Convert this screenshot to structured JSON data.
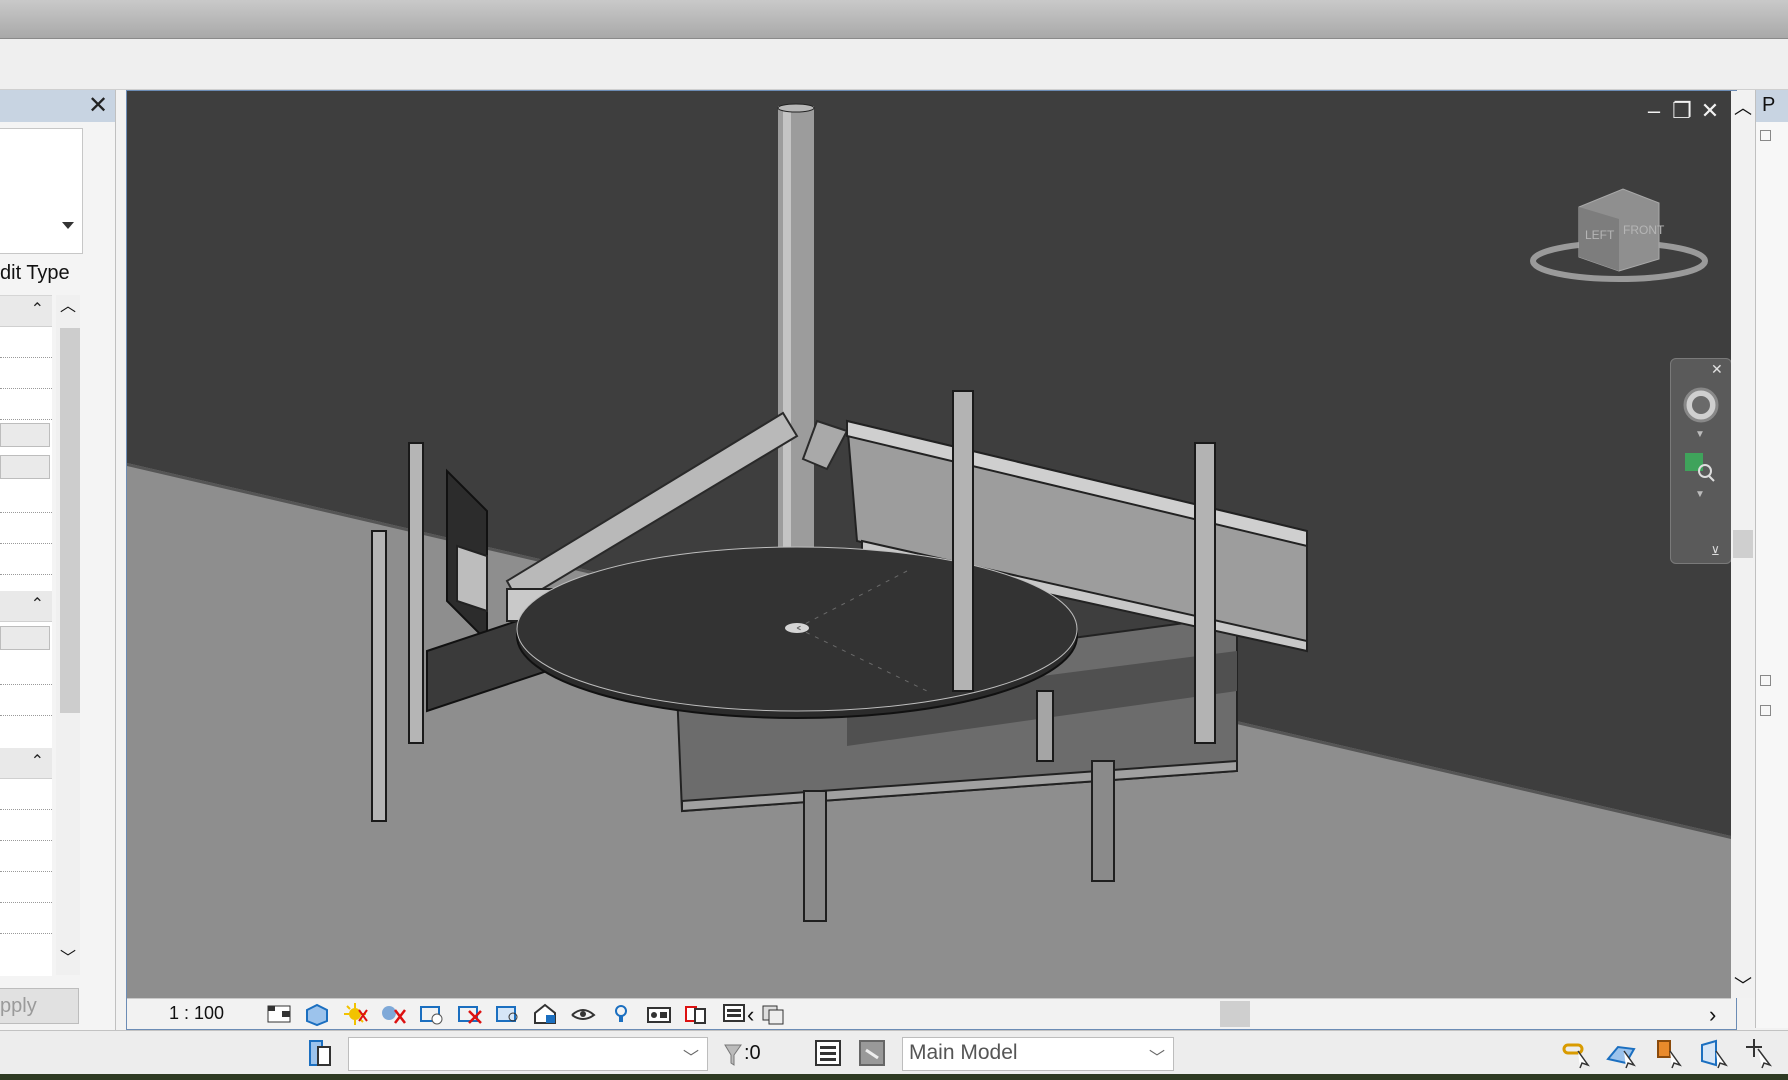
{
  "properties_panel": {
    "edit_type_label": "dit Type",
    "apply_label": "pply",
    "close_glyph": "✕"
  },
  "view": {
    "scale": "1 : 100",
    "view_cube_faces": [
      "LEFT",
      "FRONT"
    ]
  },
  "status_bar": {
    "selection_count": ":0",
    "active_workset": "Main Model"
  },
  "project_browser": {
    "title_fragment": "P"
  },
  "colors": {
    "viewport_background": "#3e3e3e",
    "floor": "#8e8e8e",
    "panel_header": "#c8d4e2",
    "accent_blue": "#1b6fc0"
  },
  "icons": {
    "view_control_bar": [
      "detail-level-icon",
      "visual-style-icon",
      "sun-path-icon",
      "shadows-icon",
      "show-rendering-icon",
      "crop-view-icon",
      "show-crop-region-icon",
      "unlock-3d-view-icon",
      "temporary-hide-isolate-icon",
      "reveal-hidden-icon",
      "analytical-model-icon",
      "highlight-displacement-icon",
      "reveal-constraints-icon",
      "worksharing-display-icon"
    ],
    "selection_toggles": [
      "select-links-icon",
      "select-underlay-icon",
      "select-pinned-icon",
      "select-by-face-icon",
      "drag-on-selection-icon"
    ]
  }
}
